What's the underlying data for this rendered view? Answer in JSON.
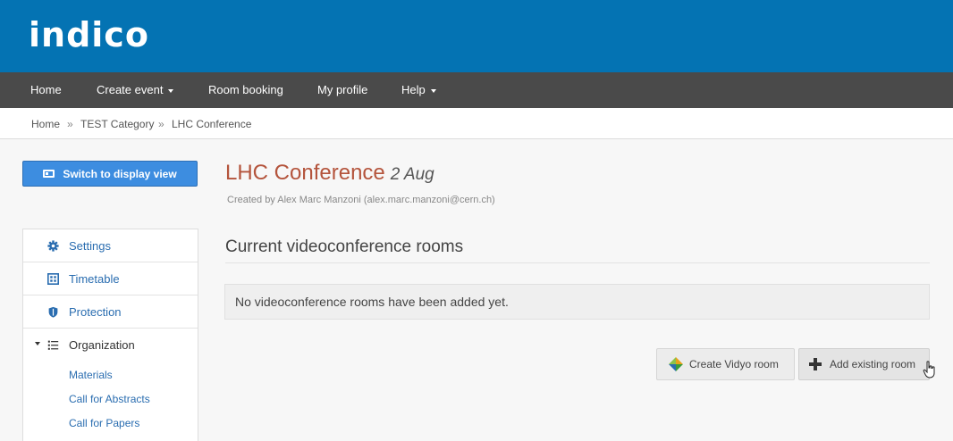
{
  "header": {
    "logo_text": "indico"
  },
  "nav": {
    "items": [
      {
        "label": "Home",
        "has_caret": false
      },
      {
        "label": "Create event",
        "has_caret": true
      },
      {
        "label": "Room booking",
        "has_caret": false
      },
      {
        "label": "My profile",
        "has_caret": false
      },
      {
        "label": "Help",
        "has_caret": true
      }
    ]
  },
  "breadcrumb": {
    "items": [
      "Home",
      "TEST Category",
      "LHC Conference"
    ],
    "separator": "»"
  },
  "sidebar": {
    "display_button": "Switch to display view",
    "menu": [
      {
        "label": "Settings",
        "icon": "gear-icon"
      },
      {
        "label": "Timetable",
        "icon": "timetable-icon"
      },
      {
        "label": "Protection",
        "icon": "shield-icon"
      },
      {
        "label": "Organization",
        "icon": "list-icon",
        "expanded": true
      }
    ],
    "submenu": [
      "Materials",
      "Call for Abstracts",
      "Call for Papers"
    ]
  },
  "event": {
    "title": "LHC Conference",
    "date": "2 Aug",
    "created_by": "Created by Alex Marc Manzoni (alex.marc.manzoni@cern.ch)"
  },
  "videoconference": {
    "section_title": "Current videoconference rooms",
    "empty_message": "No videoconference rooms have been added yet.",
    "create_button": "Create Vidyo room",
    "add_button": "Add existing room"
  },
  "colors": {
    "header_bg": "#0473b3",
    "nav_bg": "#4a4a4a",
    "accent_blue": "#3d8de0",
    "title_color": "#b4543c",
    "link_color": "#2a6db0"
  }
}
